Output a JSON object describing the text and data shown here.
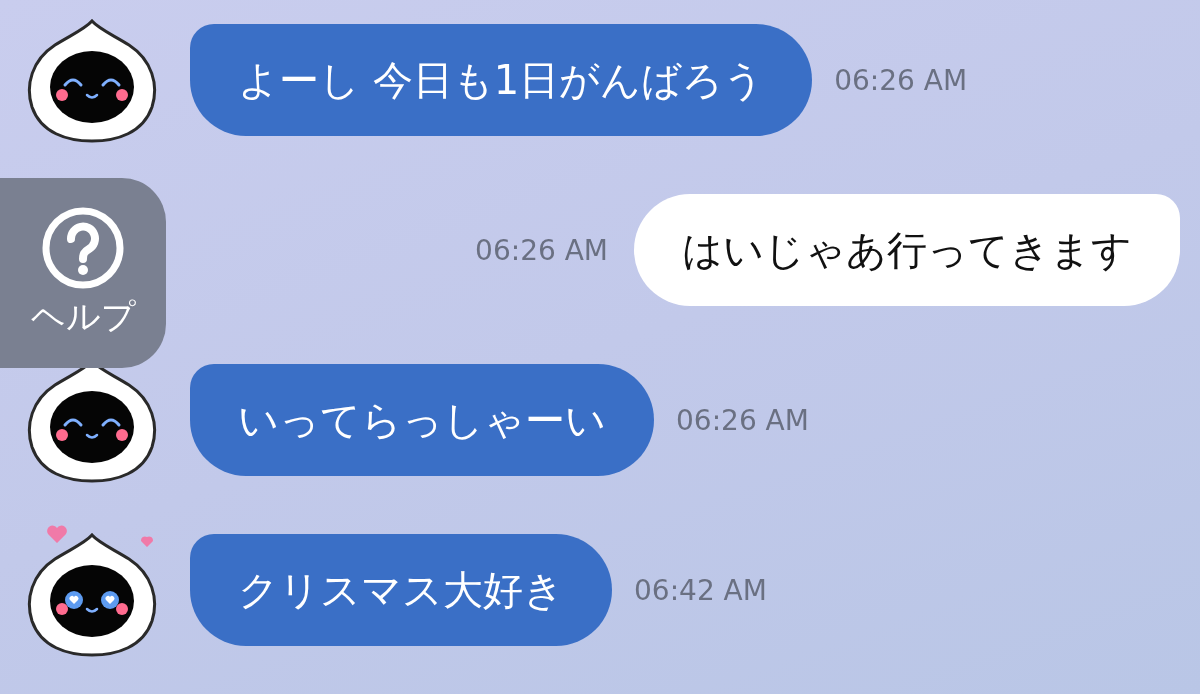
{
  "help_button": {
    "label": "ヘルプ"
  },
  "messages": [
    {
      "kind": "smile",
      "text": "よーし 今日も1日がんばろう",
      "time": "06:26 AM"
    },
    {
      "kind": "outgoing",
      "text": "はいじゃあ行ってきます",
      "time": "06:26 AM"
    },
    {
      "kind": "smile",
      "text": "いってらっしゃーい",
      "time": "06:26 AM"
    },
    {
      "kind": "love",
      "text": "クリスマス大好き",
      "time": "06:42 AM"
    }
  ]
}
